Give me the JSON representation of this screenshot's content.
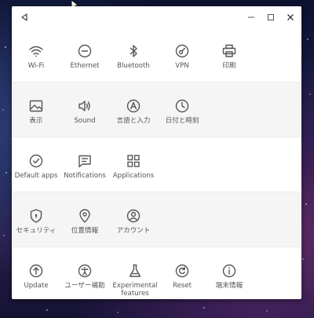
{
  "window": {
    "titlebar": {
      "back_icon": "back-triangle-icon",
      "minimize_icon": "minimize-icon",
      "maximize_icon": "maximize-icon",
      "close_icon": "close-icon"
    }
  },
  "rows": [
    {
      "items": [
        {
          "label": "Wi-Fi",
          "icon": "wifi-icon"
        },
        {
          "label": "Ethernet",
          "icon": "ethernet-icon"
        },
        {
          "label": "Bluetooth",
          "icon": "bluetooth-icon"
        },
        {
          "label": "VPN",
          "icon": "vpn-icon"
        },
        {
          "label": "印刷",
          "icon": "printer-icon"
        }
      ]
    },
    {
      "items": [
        {
          "label": "表示",
          "icon": "display-icon"
        },
        {
          "label": "Sound",
          "icon": "sound-icon"
        },
        {
          "label": "言語と入力",
          "icon": "language-icon"
        },
        {
          "label": "日付と時刻",
          "icon": "clock-icon"
        }
      ]
    },
    {
      "items": [
        {
          "label": "Default apps",
          "icon": "default-apps-icon"
        },
        {
          "label": "Notifications",
          "icon": "notifications-icon"
        },
        {
          "label": "Applications",
          "icon": "applications-icon"
        }
      ]
    },
    {
      "items": [
        {
          "label": "セキュリティ",
          "icon": "security-icon"
        },
        {
          "label": "位置情報",
          "icon": "location-icon"
        },
        {
          "label": "アカウント",
          "icon": "account-icon"
        }
      ]
    },
    {
      "items": [
        {
          "label": "Update",
          "icon": "update-icon"
        },
        {
          "label": "ユーザー補助",
          "icon": "accessibility-icon"
        },
        {
          "label": "Experimental features",
          "label_line1": "Experimental",
          "label_line2": "features",
          "icon": "experimental-icon"
        },
        {
          "label": "Reset",
          "icon": "reset-icon"
        },
        {
          "label": "端末情報",
          "icon": "info-icon"
        }
      ]
    }
  ],
  "colors": {
    "icon": "#555555",
    "label": "#555555",
    "window_bg": "#ffffff",
    "shade_row": "#f5f5f5"
  }
}
